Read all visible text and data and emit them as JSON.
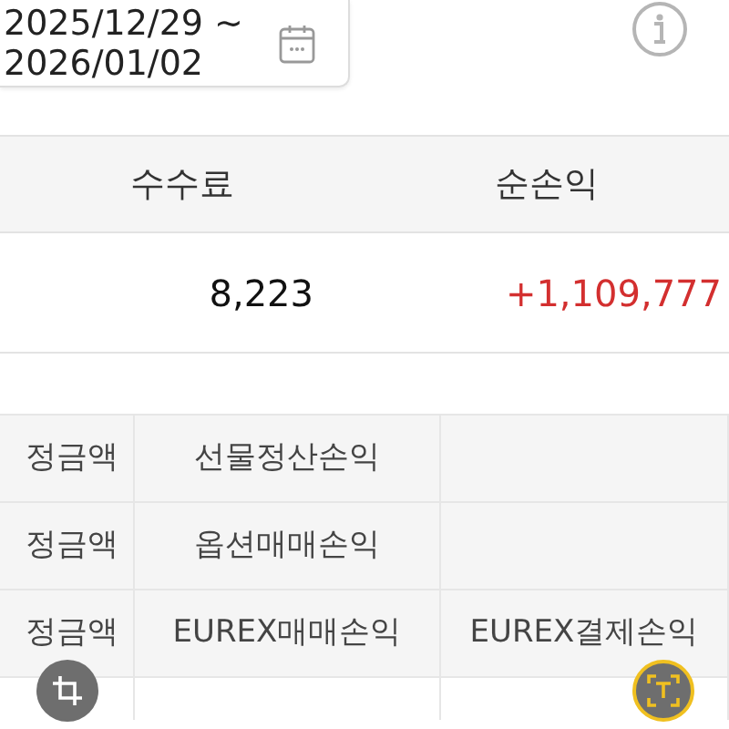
{
  "date_range": {
    "start": "2025/12/29 ~",
    "end": "2026/01/02"
  },
  "summary_table": {
    "columns": [
      "수수료",
      "순손익"
    ],
    "rows": [
      {
        "cells": [
          {
            "text": "8,223",
            "kind": "plain"
          },
          {
            "text": "+1,109,777",
            "kind": "gain"
          }
        ]
      }
    ]
  },
  "detail_table": {
    "rows": [
      [
        "정금액",
        "선물정산손익",
        ""
      ],
      [
        "정금액",
        "옵션매매손익",
        ""
      ],
      [
        "정금액",
        "EUREX매매손익",
        "EUREX결제손익"
      ]
    ]
  }
}
